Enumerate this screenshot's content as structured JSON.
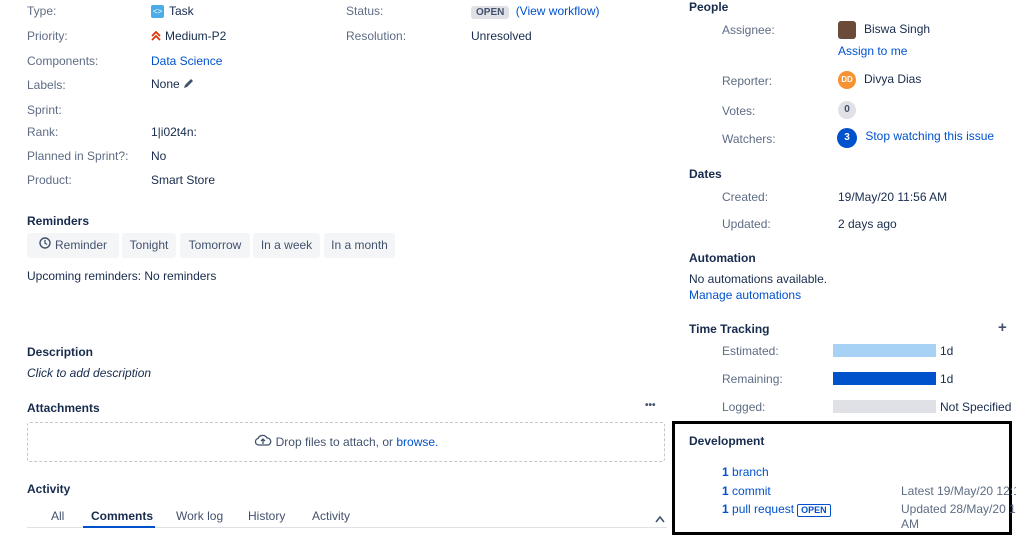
{
  "details": {
    "type": {
      "label": "Type:",
      "value": "Task"
    },
    "priority": {
      "label": "Priority:",
      "value": "Medium-P2"
    },
    "components": {
      "label": "Components:",
      "value": "Data Science"
    },
    "labels": {
      "label": "Labels:",
      "value": "None"
    },
    "sprint": {
      "label": "Sprint:",
      "value": ""
    },
    "rank": {
      "label": "Rank:",
      "value": "1|i02t4n:"
    },
    "planned": {
      "label": "Planned in Sprint?:",
      "value": "No"
    },
    "product": {
      "label": "Product:",
      "value": "Smart Store"
    },
    "status": {
      "label": "Status:",
      "value": "OPEN",
      "workflow_link": "(View workflow)"
    },
    "resolution": {
      "label": "Resolution:",
      "value": "Unresolved"
    }
  },
  "reminders": {
    "title": "Reminders",
    "buttons": [
      "Reminder",
      "Tonight",
      "Tomorrow",
      "In a week",
      "In a month"
    ],
    "upcoming_label": "Upcoming reminders:",
    "upcoming_value": "No reminders"
  },
  "description": {
    "title": "Description",
    "placeholder": "Click to add description"
  },
  "attachments": {
    "title": "Attachments",
    "more": "•••",
    "drop_text": "Drop files to attach, or ",
    "browse": "browse."
  },
  "activity": {
    "title": "Activity",
    "tabs": [
      "All",
      "Comments",
      "Work log",
      "History",
      "Activity"
    ],
    "active_tab": "Comments"
  },
  "people": {
    "title": "People",
    "assignee_label": "Assignee:",
    "assignee": "Biswa Singh",
    "assign_me": "Assign to me",
    "reporter_label": "Reporter:",
    "reporter": "Divya Dias",
    "reporter_initials": "DD",
    "votes_label": "Votes:",
    "votes": "0",
    "watchers_label": "Watchers:",
    "watchers": "3",
    "stop_watching": "Stop watching this issue"
  },
  "dates": {
    "title": "Dates",
    "created_label": "Created:",
    "created": "19/May/20 11:56 AM",
    "updated_label": "Updated:",
    "updated": "2 days ago"
  },
  "automation": {
    "title": "Automation",
    "none_text": "No automations available.",
    "manage": "Manage automations"
  },
  "time_tracking": {
    "title": "Time Tracking",
    "add": "+",
    "estimated_label": "Estimated:",
    "estimated": "1d",
    "estimated_fill": 1.0,
    "remaining_label": "Remaining:",
    "remaining": "1d",
    "remaining_fill": 1.0,
    "logged_label": "Logged:",
    "logged": "Not Specified",
    "logged_fill": 0.0
  },
  "development": {
    "title": "Development",
    "branch_count": "1",
    "branch_text": "branch",
    "commit_count": "1",
    "commit_text": "commit",
    "commit_meta": "Latest 19/May/20 12:1",
    "pr_count": "1",
    "pr_text": "pull request",
    "pr_status": "OPEN",
    "pr_meta_line1": "Updated 28/May/20 1",
    "pr_meta_line2": "AM"
  },
  "colors": {
    "link": "#0052cc",
    "estimated_bar": "#a7d1f5",
    "remaining_bar": "#0052cc",
    "logged_bar": "#dfe1e6",
    "reporter_avatar": "#f79232"
  }
}
